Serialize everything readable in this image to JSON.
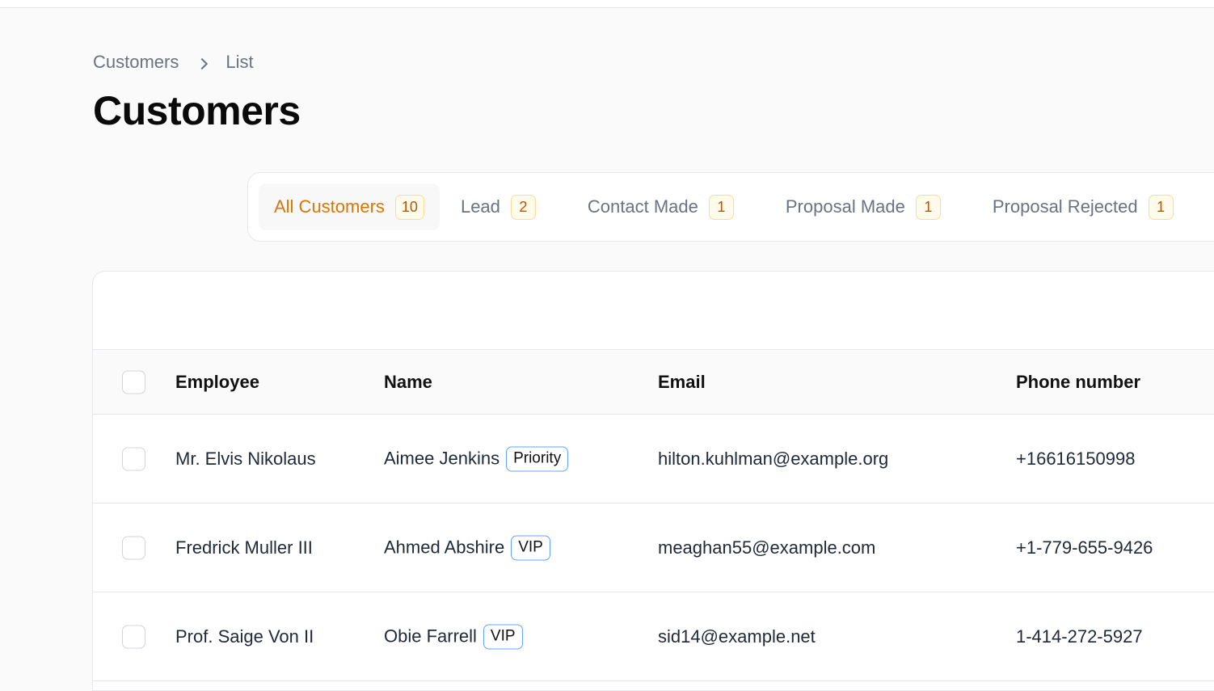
{
  "breadcrumb": {
    "items": [
      "Customers",
      "List"
    ]
  },
  "page": {
    "title": "Customers"
  },
  "tabs": [
    {
      "label": "All Customers",
      "count": "10",
      "active": true
    },
    {
      "label": "Lead",
      "count": "2"
    },
    {
      "label": "Contact Made",
      "count": "1"
    },
    {
      "label": "Proposal Made",
      "count": "1"
    },
    {
      "label": "Proposal Rejected",
      "count": "1"
    }
  ],
  "table": {
    "columns": [
      "Employee",
      "Name",
      "Email",
      "Phone number"
    ],
    "rows": [
      {
        "employee": "Mr. Elvis Nikolaus",
        "name": "Aimee Jenkins",
        "tag": "Priority",
        "email": "hilton.kuhlman@example.org",
        "phone": "+16616150998"
      },
      {
        "employee": "Fredrick Muller III",
        "name": "Ahmed Abshire",
        "tag": "VIP",
        "email": "meaghan55@example.com",
        "phone": "+1-779-655-9426"
      },
      {
        "employee": "Prof. Saige Von II",
        "name": "Obie Farrell",
        "tag": "VIP",
        "email": "sid14@example.net",
        "phone": "1-414-272-5927"
      }
    ]
  },
  "colors": {
    "accent": "#d97706",
    "tag_border": "#60a5fa"
  }
}
